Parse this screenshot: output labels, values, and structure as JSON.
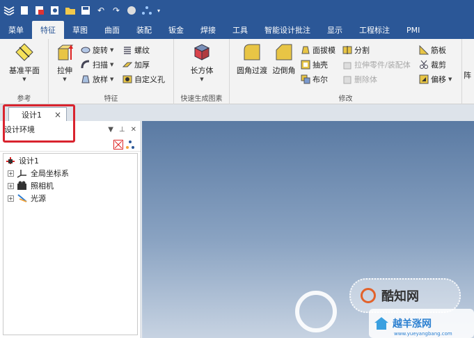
{
  "tabs": [
    "菜单",
    "特征",
    "草图",
    "曲面",
    "装配",
    "钣金",
    "焊接",
    "工具",
    "智能设计批注",
    "显示",
    "工程标注",
    "PMI"
  ],
  "active_tab": "特征",
  "ribbon": {
    "groups": {
      "reference": {
        "label": "参考",
        "ref_plane": "基准平面"
      },
      "feature": {
        "label": "特征",
        "extrude": "拉伸",
        "revolve": "旋转",
        "sweep": "扫描",
        "loft": "放样",
        "thread": "螺纹",
        "thicken": "加厚",
        "custom_hole": "自定义孔"
      },
      "quick": {
        "label": "快速生成图素",
        "box": "长方体"
      },
      "modify": {
        "label": "修改",
        "fillet": "圆角过渡",
        "chamfer": "边倒角",
        "draft": "面拔模",
        "shell": "抽壳",
        "boolean": "布尔",
        "split": "分割",
        "extrude_to": "拉伸零件/装配体",
        "delete_body": "删除体",
        "rib": "筋板",
        "trim": "裁剪",
        "offset": "偏移"
      },
      "partial": "阵"
    }
  },
  "doc_tab": {
    "label": "设计1",
    "close": "×"
  },
  "panel": {
    "title": "设计环境",
    "pin": "▼ 📌 ✕"
  },
  "tree": {
    "root": "设计1",
    "children": [
      "全局坐标系",
      "照相机",
      "光源"
    ]
  },
  "watermark": {
    "brand": "酷知网",
    "brand2": "越羊涨网",
    "url": "www.yueyangbang.com"
  },
  "colors": {
    "titlebar": "#2b5797",
    "ribbon_bg": "#f3f3f3",
    "highlight": "#d9232e"
  }
}
